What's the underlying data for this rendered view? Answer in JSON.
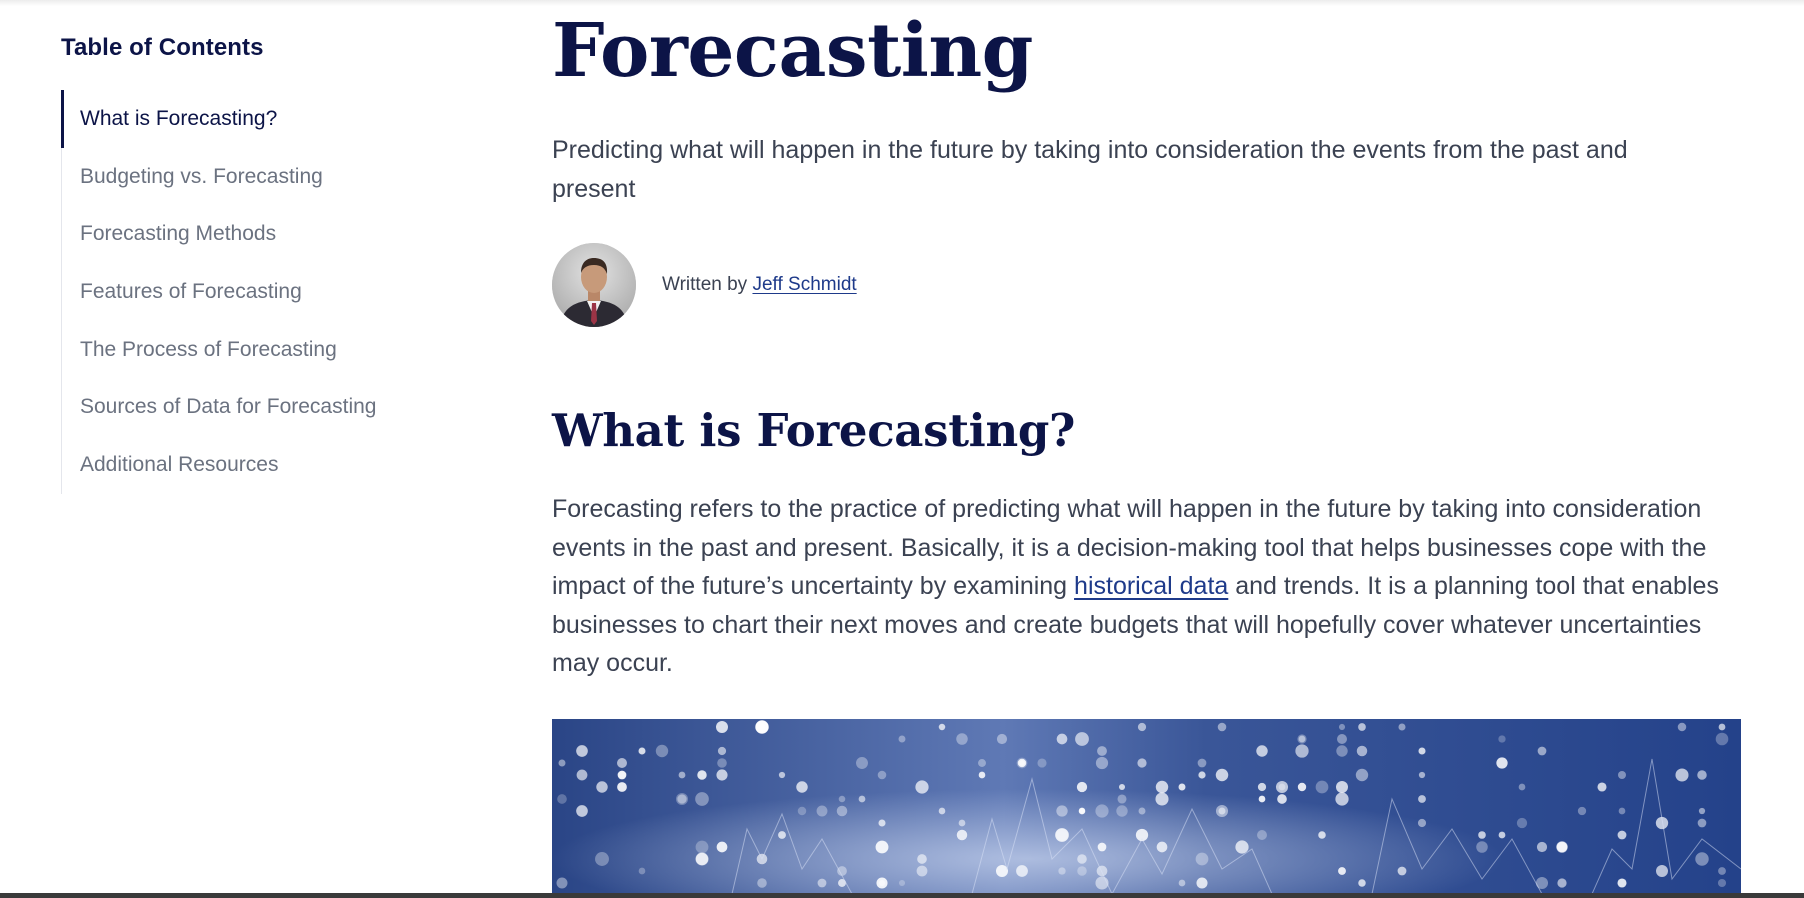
{
  "toc": {
    "title": "Table of Contents",
    "items": [
      {
        "label": "What is Forecasting?",
        "active": true
      },
      {
        "label": "Budgeting vs. Forecasting",
        "active": false
      },
      {
        "label": "Forecasting Methods",
        "active": false
      },
      {
        "label": "Features of Forecasting",
        "active": false
      },
      {
        "label": "The Process of Forecasting",
        "active": false
      },
      {
        "label": "Sources of Data for Forecasting",
        "active": false
      },
      {
        "label": "Additional Resources",
        "active": false
      }
    ]
  },
  "article": {
    "title": "Forecasting",
    "subtitle": "Predicting what will happen in the future by taking into consideration the events from the past and present",
    "byline": {
      "prefix": "Written by",
      "author": "Jeff Schmidt"
    },
    "section_heading": "What is Forecasting?",
    "paragraph": {
      "part1": "Forecasting refers to the practice of predicting what will happen in the future by taking into consideration events in the past and present. Basically, it is a decision-making tool that helps businesses cope with the impact of the future’s uncertainty by examining",
      "link": "historical data",
      "part2": "and trends. It is a planning tool that enables businesses to chart their next moves and create budgets that will hopefully cover whatever uncertainties may occur."
    }
  },
  "colors": {
    "heading": "#0c1447",
    "body": "#3b4252",
    "link": "#1e3a8a",
    "muted": "#6b7280",
    "hero_blue": "#2b4a8e"
  }
}
